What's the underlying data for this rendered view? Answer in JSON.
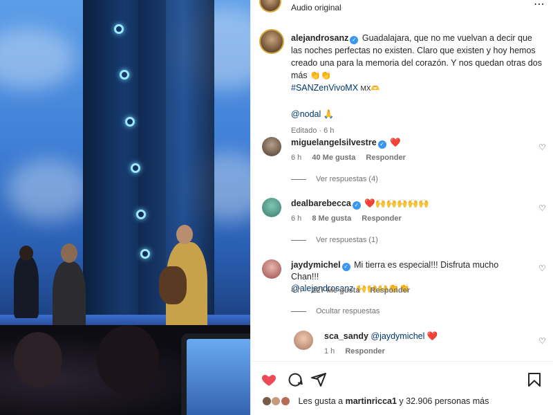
{
  "header": {
    "subtitle": "Audio original",
    "more": "⋯"
  },
  "caption": {
    "username": "alejandrosanz",
    "text_line1": "Guadalajara, que no me vuelvan a decir que las noches perfectas no existen. Claro que existen y hoy hemos creado una para la memoria del corazón. Y nos quedan otras dos más 👏👏",
    "hashtag": "#SANZenVivoMX",
    "flag_text": "MX🫶",
    "mention": "@nodal",
    "mention_emoji": "🙏",
    "edited": "Editado",
    "time": "6 h"
  },
  "comments": [
    {
      "username": "miguelangelsilvestre",
      "text": "❤️",
      "time": "6 h",
      "likes": "40 Me gusta",
      "reply_label": "Responder",
      "view_replies": "Ver respuestas (4)"
    },
    {
      "username": "dealbarebecca",
      "text": "❤️🙌🙌🙌🙌🙌",
      "time": "6 h",
      "likes": "8 Me gusta",
      "reply_label": "Responder",
      "view_replies": "Ver respuestas (1)"
    },
    {
      "username": "jaydymichel",
      "text": "Mi tierra es especial!!! Disfruta mucho Chan!!!",
      "mention": "@alejandrosanz",
      "text_after": "🙌🙌🙌👏👏",
      "time": "4 h",
      "likes": "227 Me gusta",
      "reply_label": "Responder",
      "hide_replies": "Ocultar respuestas"
    }
  ],
  "reply": {
    "username": "sca_sandy",
    "mention": "@jaydymichel",
    "text": "❤️",
    "time": "1 h",
    "reply_label": "Responder"
  },
  "actions": {
    "likes_prefix": "Les gusta a",
    "likes_user": "martinricca1",
    "likes_suffix": "y 32.906 personas más"
  },
  "icons": [
    "heart-filled-icon",
    "comment-icon",
    "share-icon",
    "bookmark-icon",
    "heart-outline-icon",
    "more-icon",
    "verified-icon"
  ],
  "colors": {
    "like_red": "#ed4956",
    "verified_blue": "#3897f0",
    "link": "#00376b",
    "meta_gray": "#737373"
  }
}
